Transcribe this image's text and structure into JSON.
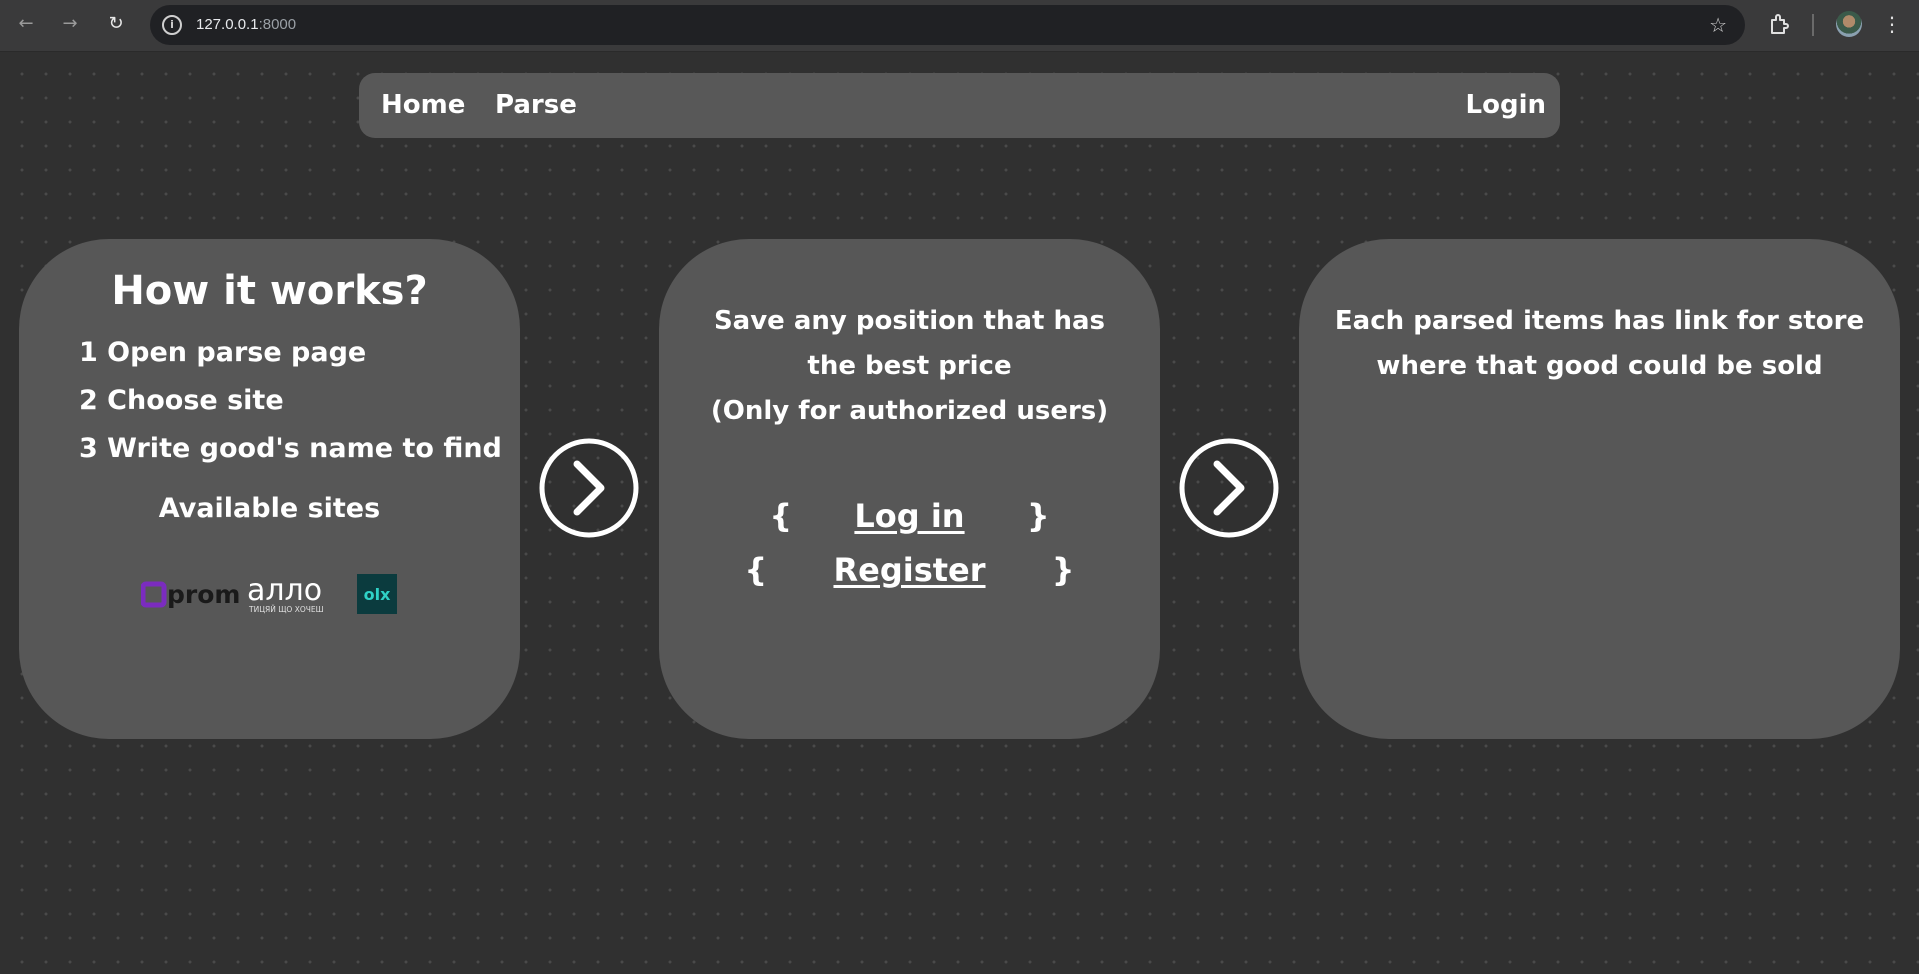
{
  "browser": {
    "url_host": "127.0.0.1",
    "url_port": ":8000",
    "back_glyph": "←",
    "forward_glyph": "→",
    "reload_glyph": "↻",
    "star_glyph": "☆",
    "menu_glyph": "⋮"
  },
  "nav": {
    "home": "Home",
    "parse": "Parse",
    "login": "Login"
  },
  "how_it_works": {
    "title": "How it works?",
    "steps": [
      "1 Open parse page",
      "2 Choose site",
      "3 Write good's name to find"
    ],
    "available_sites_label": "Available sites",
    "sites": [
      "prom",
      "аллo",
      "olx"
    ],
    "allo_tagline": "ТИЦЯЙ ЩО ХОЧЕШ"
  },
  "save_card": {
    "line1": "Save any position that has",
    "line2": "the best price",
    "line3": "(Only for authorized users)",
    "open_brace": "{",
    "close_brace": "}",
    "login_link": "Log in",
    "register_link": "Register"
  },
  "store_card": {
    "line1": "Each parsed items has link for store",
    "line2": "where that good could be sold"
  },
  "colors": {
    "background": "#303030",
    "card": "#575757",
    "nav": "#585858",
    "prom_purple": "#7b2cbf",
    "olx_teal": "#0b3b3e"
  }
}
